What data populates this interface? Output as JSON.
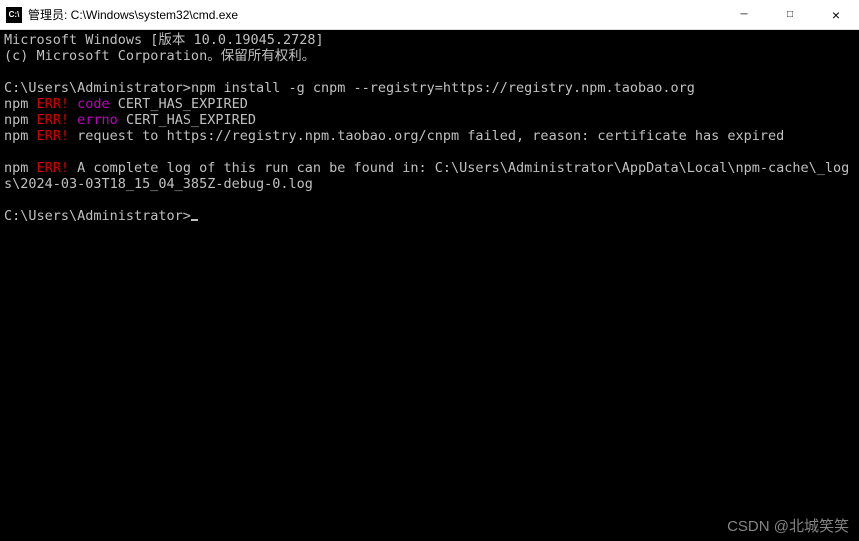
{
  "titlebar": {
    "icon_text": "C:\\",
    "title": "管理员: C:\\Windows\\system32\\cmd.exe",
    "minimize": "─",
    "maximize": "□",
    "close": "×"
  },
  "terminal": {
    "line1": "Microsoft Windows [版本 10.0.19045.2728]",
    "line2": "(c) Microsoft Corporation。保留所有权利。",
    "prompt1_path": "C:\\Users\\Administrator>",
    "prompt1_cmd": "npm install -g cnpm --registry=https://registry.npm.taobao.org",
    "npm_label": "npm ",
    "err_label": "ERR!",
    "err_code_label": " code",
    "err_code_value": " CERT_HAS_EXPIRED",
    "err_errno_label": " errno",
    "err_errno_value": " CERT_HAS_EXPIRED",
    "err_request": " request to https://registry.npm.taobao.org/cnpm failed, reason: certificate has expired",
    "err_log": " A complete log of this run can be found in: C:\\Users\\Administrator\\AppData\\Local\\npm-cache\\_logs\\2024-03-03T18_15_04_385Z-debug-0.log",
    "prompt2_path": "C:\\Users\\Administrator>"
  },
  "watermark": "CSDN @北城笑笑"
}
